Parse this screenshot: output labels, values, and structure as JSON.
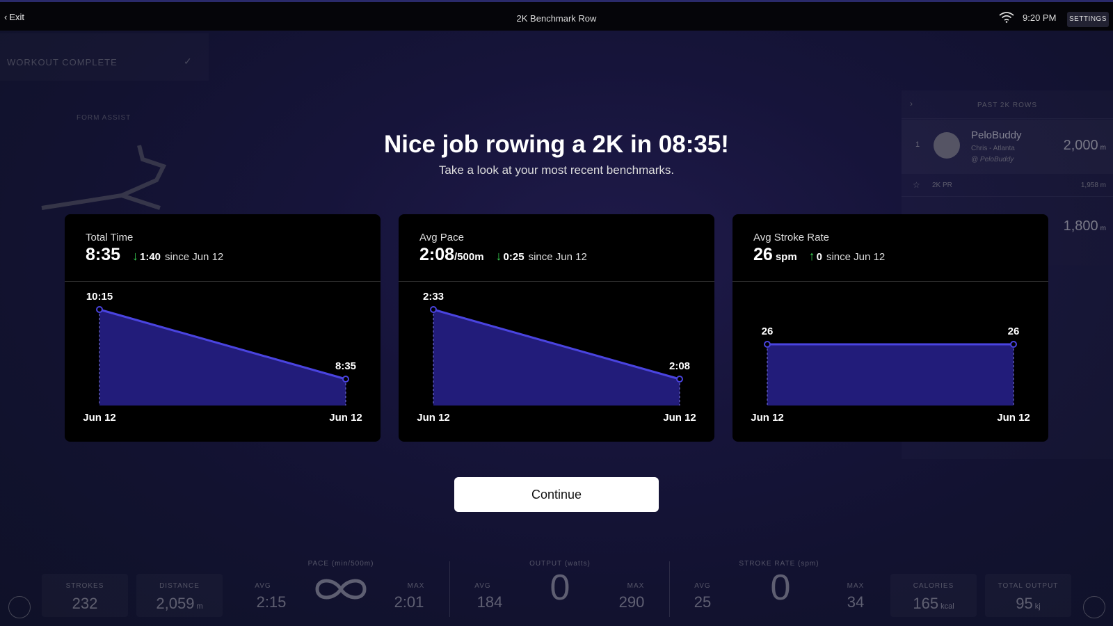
{
  "topbar": {
    "exit_label": "Exit",
    "title": "2K Benchmark Row",
    "time": "9:20 PM",
    "settings_label": "SETTINGS"
  },
  "background_left": {
    "workout_complete": "WORKOUT COMPLETE",
    "form_assist": "FORM ASSIST"
  },
  "background_right": {
    "header": "PAST 2K ROWS",
    "entry": {
      "rank": "1",
      "name": "PeloBuddy",
      "location": "Chris - Atlanta",
      "tag": "@ PeloBuddy",
      "distance": "2,000",
      "distance_unit": "m"
    },
    "pr_label": "2K PR",
    "pr_value": "1,958 m",
    "entry2_distance": "1,800",
    "entry2_unit": "m"
  },
  "headline": "Nice job rowing a 2K in 08:35!",
  "subline": "Take a look at your most recent benchmarks.",
  "cards": [
    {
      "label": "Total Time",
      "value": "8:35",
      "unit": "",
      "delta_direction": "down",
      "delta": "1:40",
      "since": "since Jun 12",
      "chart": {
        "start_label": "10:15",
        "end_label": "8:35",
        "start_date": "Jun 12",
        "end_date": "Jun 12",
        "start_value": 615,
        "end_value": 515
      }
    },
    {
      "label": "Avg Pace",
      "value": "2:08",
      "unit": "/500m",
      "delta_direction": "down",
      "delta": "0:25",
      "since": "since Jun 12",
      "chart": {
        "start_label": "2:33",
        "end_label": "2:08",
        "start_date": "Jun 12",
        "end_date": "Jun 12",
        "start_value": 153,
        "end_value": 128
      }
    },
    {
      "label": "Avg Stroke Rate",
      "value": "26",
      "unit": "spm",
      "delta_direction": "up",
      "delta": "0",
      "since": "since Jun 12",
      "chart": {
        "start_label": "26",
        "end_label": "26",
        "start_date": "Jun 12",
        "end_date": "Jun 12",
        "start_value": 26,
        "end_value": 26
      }
    }
  ],
  "continue_label": "Continue",
  "metrics": {
    "strokes_label": "STROKES",
    "strokes_value": "232",
    "distance_label": "DISTANCE",
    "distance_value": "2,059",
    "distance_unit": "m",
    "pace_section": "PACE (min/500m)",
    "pace_avg_label": "AVG",
    "pace_avg": "2:15",
    "pace_max_label": "MAX",
    "pace_max": "2:01",
    "output_section": "OUTPUT (watts)",
    "output_avg_label": "AVG",
    "output_avg": "184",
    "output_current": "0",
    "output_max_label": "MAX",
    "output_max": "290",
    "stroke_section": "STROKE RATE (spm)",
    "stroke_avg_label": "AVG",
    "stroke_avg": "25",
    "stroke_current": "0",
    "stroke_max_label": "MAX",
    "stroke_max": "34",
    "calories_label": "CALORIES",
    "calories_value": "165",
    "calories_unit": "kcal",
    "total_output_label": "TOTAL OUTPUT",
    "total_output_value": "95",
    "total_output_unit": "kj"
  },
  "colors": {
    "accent": "#4a44e0",
    "fill": "#221c7a",
    "delta_green": "#39d353"
  }
}
